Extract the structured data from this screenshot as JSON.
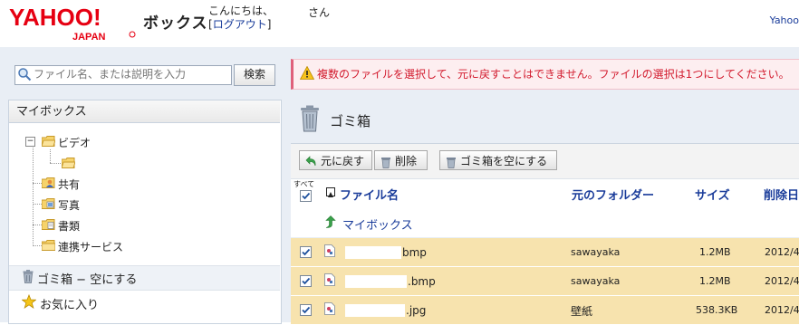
{
  "header": {
    "logo_main": "YAHOO!",
    "logo_sub": "JAPAN",
    "service_name": "ボックス",
    "greeting": "こんにちは、",
    "logout_label": "ログアウト",
    "logout_bracket_open": "[",
    "logout_bracket_close": "]",
    "user_suffix": "さん",
    "yahoo_link": "Yahoo"
  },
  "search": {
    "placeholder": "ファイル名、または説明を入力",
    "button_label": "検索"
  },
  "sidebar": {
    "title": "マイボックス",
    "tree_toggle": "−",
    "items": [
      {
        "label": "ビデオ"
      },
      {
        "label": ""
      },
      {
        "label": "共有"
      },
      {
        "label": "写真"
      },
      {
        "label": "書類"
      },
      {
        "label": "連携サービス"
      }
    ],
    "trash_label": "ゴミ箱",
    "trash_sep": " − ",
    "trash_empty_label": "空にする",
    "favorites_label": "お気に入り"
  },
  "alert": {
    "message": "複数のファイルを選択して、元に戻すことはできません。ファイルの選択は1つにしてください。"
  },
  "main": {
    "title": "ゴミ箱",
    "toolbar": {
      "restore_label": "元に戻す",
      "delete_label": "削除",
      "empty_trash_label": "ゴミ箱を空にする"
    },
    "columns": {
      "select_all": "すべて",
      "name": "ファイル名",
      "original_folder": "元のフォルダー",
      "size": "サイズ",
      "deleted": "削除日"
    },
    "parent_link": "マイボックス",
    "rows": [
      {
        "name": "bmp",
        "folder": "sawayaka",
        "size": "1.2MB",
        "deleted": "2012/4/",
        "checked": true
      },
      {
        "name": ".bmp",
        "folder": "sawayaka",
        "size": "1.2MB",
        "deleted": "2012/4/",
        "checked": true
      },
      {
        "name": ".jpg",
        "folder": "壁紙",
        "size": "538.3KB",
        "deleted": "2012/4/",
        "checked": true
      }
    ]
  },
  "colors": {
    "link_blue": "#1a3c9a",
    "alert_red": "#d21a2d",
    "selected_row": "#f7e3ae",
    "yahoo_red": "#e60012"
  }
}
